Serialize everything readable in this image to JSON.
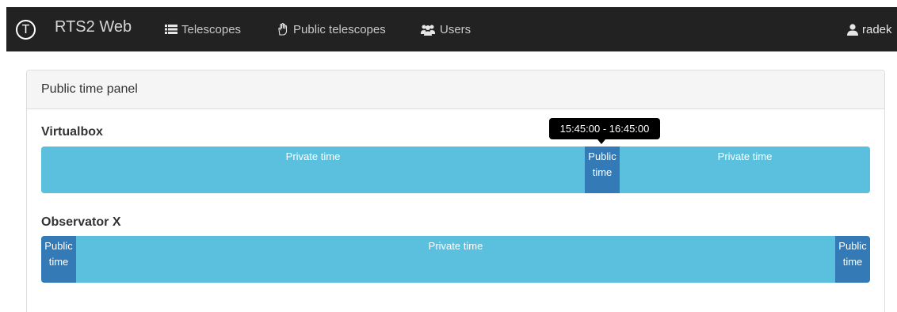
{
  "navbar": {
    "brand_letter": "T",
    "brand": "RTS2 Web",
    "items": [
      {
        "label": "Telescopes",
        "icon": "list-icon"
      },
      {
        "label": "Public telescopes",
        "icon": "hand-icon"
      },
      {
        "label": "Users",
        "icon": "users-icon"
      }
    ],
    "user": {
      "label": "radek",
      "icon": "user-icon"
    }
  },
  "panel": {
    "title": "Public time panel"
  },
  "telescopes": [
    {
      "name": "Virtualbox",
      "segments": [
        {
          "type": "private",
          "label": "Private time"
        },
        {
          "type": "public",
          "label_line1": "Public",
          "label_line2": "time"
        },
        {
          "type": "private",
          "label": "Private time"
        }
      ]
    },
    {
      "name": "Observator X",
      "segments": [
        {
          "type": "public",
          "label_line1": "Public",
          "label_line2": "time"
        },
        {
          "type": "private",
          "label": "Private time"
        },
        {
          "type": "public",
          "label_line1": "Public",
          "label_line2": "time"
        }
      ]
    }
  ],
  "tooltip": {
    "text": "15:45:00 - 16:45:00"
  },
  "colors": {
    "navbar": "#222222",
    "private": "#5bc0de",
    "public": "#337ab7"
  }
}
